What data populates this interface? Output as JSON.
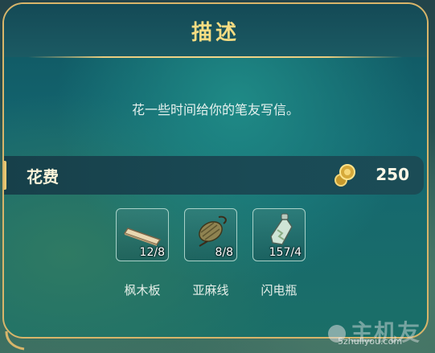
{
  "dialog": {
    "title": "描述",
    "description": "花一些时间给你的笔友写信。",
    "cost": {
      "label": "花费",
      "value": "250",
      "icon": "coin-icon"
    }
  },
  "materials": [
    {
      "name": "枫木板",
      "count": "12/8",
      "icon": "maple-plank-icon"
    },
    {
      "name": "亚麻线",
      "count": "8/8",
      "icon": "linen-thread-icon"
    },
    {
      "name": "闪电瓶",
      "count": "157/4",
      "icon": "lightning-bottle-icon"
    }
  ],
  "watermark": {
    "big": "主机友",
    "small": "5zhuliyou.com"
  },
  "colors": {
    "gold": "#e8c873",
    "title": "#f6dc82",
    "panel": "#146670"
  }
}
